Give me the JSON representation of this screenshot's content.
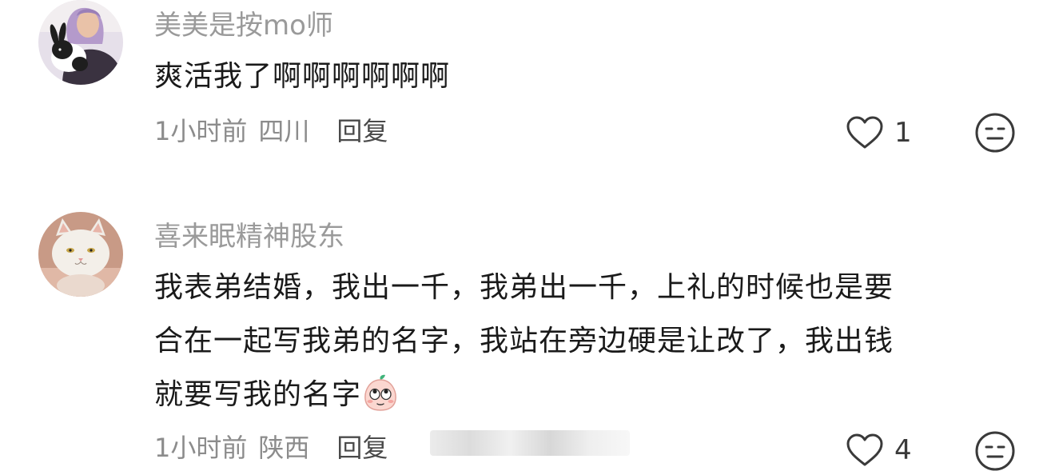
{
  "comments": [
    {
      "username": "美美是按mo师",
      "text": "爽活我了啊啊啊啊啊啊",
      "time": "1小时前",
      "region": "四川",
      "reply_label": "回复",
      "likes": "1",
      "avatar_icon": "avatar-girl-with-rabbit",
      "has_emoji": false
    },
    {
      "username": "喜来眠精神股东",
      "text_lines": [
        "我表弟结婚，我出一千，我弟出一千，上礼的时候也是要",
        "合在一起写我弟的名字，我站在旁边硬是让改了，我出钱",
        "就要写我的名字"
      ],
      "time": "1小时前",
      "region": "陕西",
      "reply_label": "回复",
      "likes": "4",
      "avatar_icon": "avatar-white-cat",
      "emoji_icon": "peach-eye-roll-emoji"
    }
  ],
  "colors": {
    "username": "#9a9a9a",
    "meta": "#8c8c8c",
    "text": "#1a1a1a",
    "icon_stroke": "#3a3a3a"
  }
}
